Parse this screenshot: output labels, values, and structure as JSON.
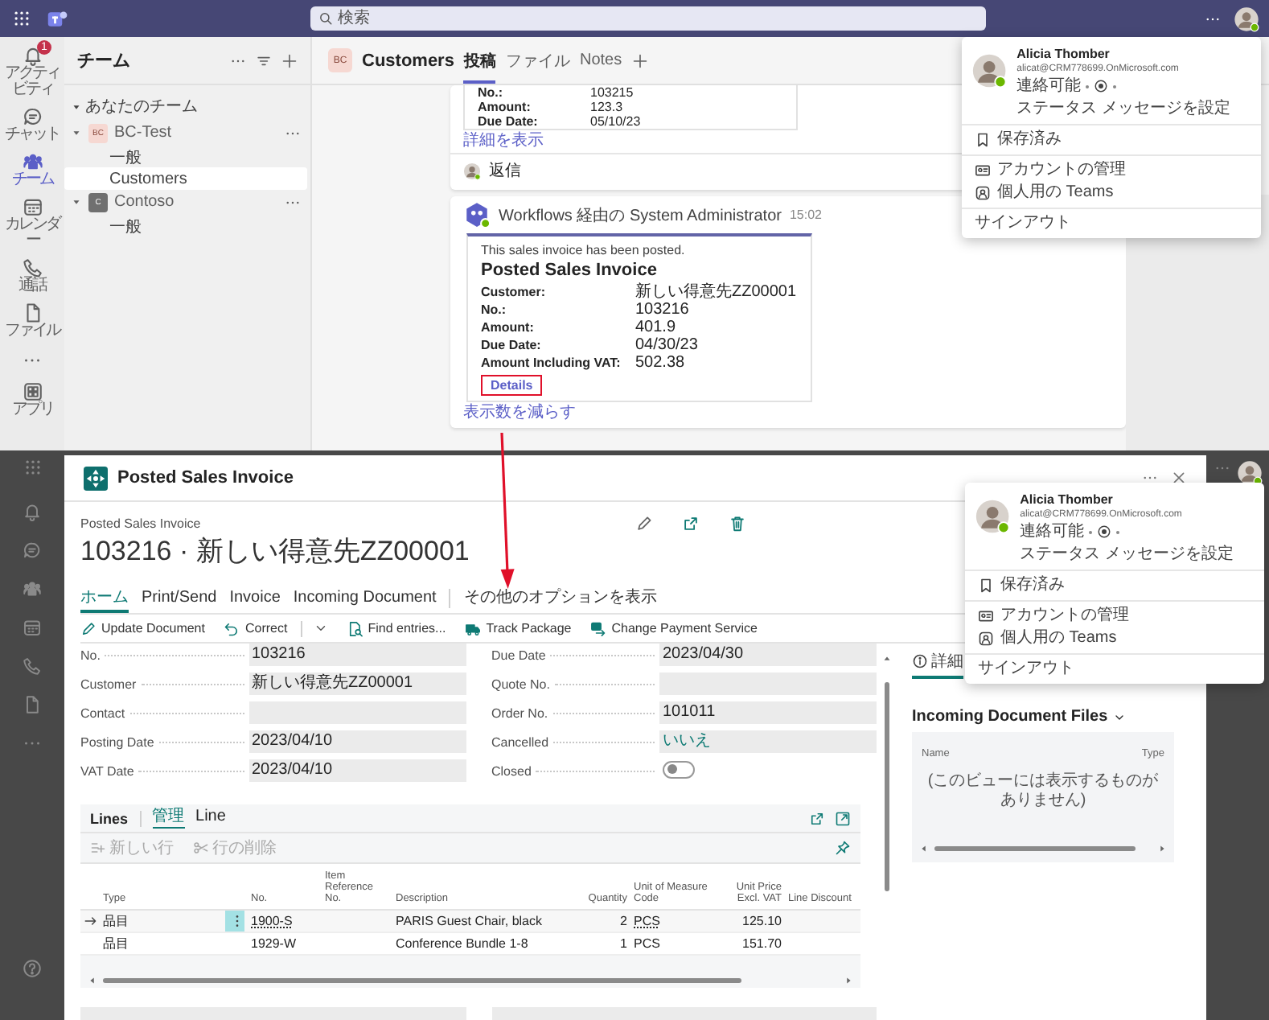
{
  "teams": {
    "search": {
      "placeholder": "検索"
    },
    "rail": [
      {
        "label": "アクティビティ",
        "badge": "1",
        "selected": false
      },
      {
        "label": "チャット",
        "selected": false
      },
      {
        "label": "チーム",
        "selected": true
      },
      {
        "label": "カレンダー",
        "selected": false
      },
      {
        "label": "通話",
        "selected": false
      },
      {
        "label": "ファイル",
        "selected": false
      },
      {
        "label": "アプリ",
        "selected": false
      }
    ],
    "team_list": {
      "title": "チーム",
      "section": "あなたのチーム",
      "teams": [
        {
          "initials": "BC",
          "name": "BC-Test",
          "color": "#f6d8d2",
          "expanded": true,
          "children": [
            {
              "name": "一般",
              "selected": false
            },
            {
              "name": "Customers",
              "selected": true
            }
          ]
        },
        {
          "initials": "C",
          "name": "Contoso",
          "color": "#707070",
          "expanded": true,
          "children": [
            {
              "name": "一般",
              "selected": false
            }
          ]
        }
      ]
    },
    "channel": {
      "initials": "BC",
      "name": "Customers",
      "tabs": [
        {
          "label": "投稿",
          "selected": true
        },
        {
          "label": "ファイル",
          "selected": false
        },
        {
          "label": "Notes",
          "selected": false
        }
      ]
    },
    "feed": {
      "earlier_card": {
        "facts": [
          {
            "label": "No.:",
            "value": "103215"
          },
          {
            "label": "Amount:",
            "value": "123.3"
          },
          {
            "label": "Due Date:",
            "value": "05/10/23"
          }
        ],
        "link": "詳細を表示"
      },
      "reply": "返信",
      "post": {
        "author": "Workflows 経由の System Administrator",
        "time": "15:02",
        "card": {
          "note": "This sales invoice has been posted.",
          "title": "Posted Sales Invoice",
          "facts": [
            {
              "label": "Customer:",
              "value": "新しい得意先ZZ00001"
            },
            {
              "label": "No.:",
              "value": "103216"
            },
            {
              "label": "Amount:",
              "value": "401.9"
            },
            {
              "label": "Due Date:",
              "value": "04/30/23"
            },
            {
              "label": "Amount Including VAT:",
              "value": "502.38"
            }
          ],
          "button": {
            "label": "Details",
            "highlighted": true
          }
        },
        "link": "表示数を減らす"
      }
    },
    "profile_menu": {
      "name": "Alicia Thomber",
      "email": "alicat@CRM778699.OnMicrosoft.com",
      "availability": "連絡可能",
      "status_action": "ステータス メッセージを設定",
      "groups": [
        [
          "保存済み"
        ],
        [
          "アカウントの管理",
          "個人用の Teams"
        ]
      ],
      "sign_out": "サインアウト"
    }
  },
  "invoice_page": {
    "window_title": "Posted Sales Invoice",
    "breadcrumb": "Posted Sales Invoice",
    "heading": "103216 · 新しい得意先ZZ00001",
    "tabs": [
      {
        "label": "ホーム",
        "selected": true
      },
      {
        "label": "Print/Send",
        "selected": false
      },
      {
        "label": "Invoice",
        "selected": false
      },
      {
        "label": "Incoming Document",
        "selected": false
      }
    ],
    "more_options": "その他のオプションを表示",
    "actions": [
      {
        "label": "Update Document",
        "split": false
      },
      {
        "label": "Correct",
        "split": true
      },
      {
        "label": "Find entries...",
        "split": false
      },
      {
        "label": "Track Package",
        "split": false
      },
      {
        "label": "Change Payment Service",
        "split": false
      }
    ],
    "fields": {
      "left": [
        {
          "label": "No.",
          "kind": "text",
          "value": "103216"
        },
        {
          "label": "Customer",
          "kind": "text",
          "value": "新しい得意先ZZ00001"
        },
        {
          "label": "Contact",
          "kind": "empty"
        },
        {
          "label": "Posting Date",
          "kind": "text",
          "value": "2023/04/10"
        },
        {
          "label": "VAT Date",
          "kind": "text",
          "value": "2023/04/10"
        }
      ],
      "right": [
        {
          "label": "Due Date",
          "kind": "text",
          "value": "2023/04/30"
        },
        {
          "label": "Quote No.",
          "kind": "empty"
        },
        {
          "label": "Order No.",
          "kind": "text",
          "value": "101011"
        },
        {
          "label": "Cancelled",
          "kind": "link",
          "value": "いいえ"
        },
        {
          "label": "Closed",
          "kind": "toggle",
          "on": false
        }
      ]
    },
    "lines": {
      "title": "Lines",
      "tabs": [
        {
          "label": "管理",
          "selected": true
        },
        {
          "label": "Line",
          "selected": false
        }
      ],
      "actions": [
        {
          "label": "新しい行",
          "disabled": true
        },
        {
          "label": "行の削除",
          "disabled": true
        }
      ],
      "columns": [
        "Type",
        "No.",
        "Item Reference No.",
        "Description",
        "Quantity",
        "Unit of Measure Code",
        "Unit Price Excl. VAT",
        "Line Discount"
      ],
      "rows": [
        {
          "selected": true,
          "type": "品目",
          "no": "1900-S",
          "description": "PARIS Guest Chair, black",
          "quantity": "2",
          "unit": "PCS",
          "unit_price": "125.10"
        },
        {
          "selected": false,
          "type": "品目",
          "no": "1929-W",
          "description": "Conference Bundle 1-8",
          "quantity": "1",
          "unit": "PCS",
          "unit_price": "151.70"
        }
      ]
    },
    "factbox": {
      "tabs": [
        {
          "label": "詳細",
          "selected": true
        }
      ],
      "title": "Incoming Document Files",
      "columns": [
        "Name",
        "Type"
      ],
      "empty_text": "(このビューには表示するものがありません)"
    },
    "profile_menu": {
      "name": "Alicia Thomber",
      "email": "alicat@CRM778699.OnMicrosoft.com",
      "availability": "連絡可能",
      "status_action": "ステータス メッセージを設定",
      "groups": [
        [
          "保存済み"
        ],
        [
          "アカウントの管理",
          "個人用の Teams"
        ]
      ],
      "sign_out": "サインアウト"
    }
  }
}
